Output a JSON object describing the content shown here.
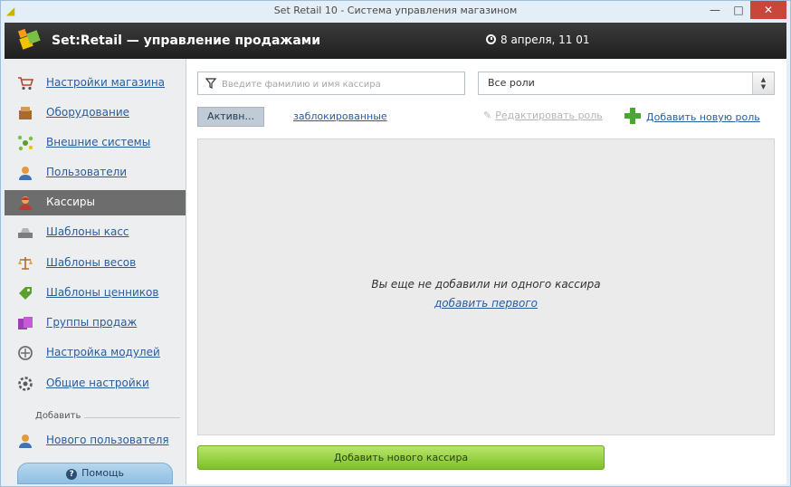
{
  "window": {
    "title": "Set Retail 10 - Система управления магазином",
    "minimize": "—",
    "maximize": "□",
    "close": "✕"
  },
  "header": {
    "brand": "Set:Retail — управление продажами",
    "clock": "8 апреля, 11 01"
  },
  "sidebar": {
    "items": [
      {
        "label": "Настройки магазина",
        "icon": "cart-icon"
      },
      {
        "label": "Оборудование",
        "icon": "equipment-icon"
      },
      {
        "label": "Внешние системы",
        "icon": "external-systems-icon"
      },
      {
        "label": "Пользователи",
        "icon": "user-icon"
      },
      {
        "label": "Кассиры",
        "icon": "cashier-icon",
        "active": true
      },
      {
        "label": "Шаблоны касс",
        "icon": "register-template-icon"
      },
      {
        "label": "Шаблоны весов",
        "icon": "scales-icon"
      },
      {
        "label": "Шаблоны ценников",
        "icon": "price-tag-icon"
      },
      {
        "label": "Группы продаж",
        "icon": "sales-group-icon"
      },
      {
        "label": "Настройка модулей",
        "icon": "modules-icon"
      },
      {
        "label": "Общие настройки",
        "icon": "general-settings-icon"
      }
    ],
    "add_section_label": "Добавить",
    "add_user_label": "Нового пользователя",
    "help_label": "Помощь"
  },
  "content": {
    "filter_placeholder": "Введите фамилию и имя кассира",
    "role_select_value": "Все роли",
    "tab_active": "Активн...",
    "tab_blocked": "заблокированные",
    "edit_role": "Редактировать роль",
    "add_role": "Добавить новую роль",
    "empty_message": "Вы еще не добавили ни одного кассира",
    "empty_link": "добавить первого",
    "add_button": "Добавить нового кассира"
  },
  "colors": {
    "link": "#2a5d9c",
    "active_item": "#6d6d6d",
    "header": "#2b2b2b",
    "add_button": "#8fcc3a",
    "close_button": "#c9463d"
  }
}
